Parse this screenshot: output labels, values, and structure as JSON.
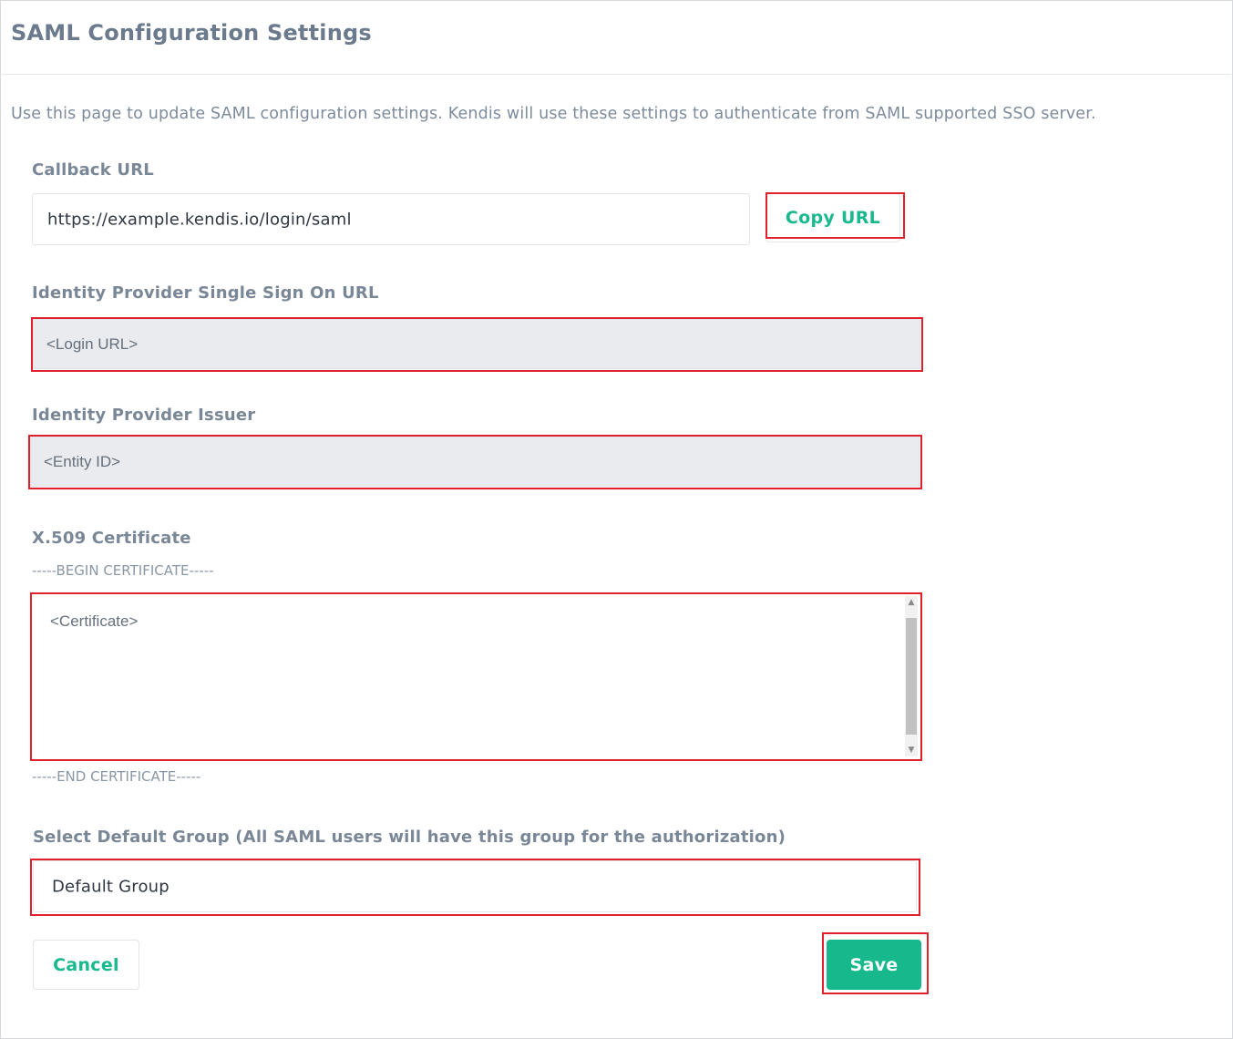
{
  "page": {
    "title": "SAML Configuration Settings",
    "description": "Use this page to update SAML configuration settings. Kendis will use these settings to authenticate from SAML supported SSO server."
  },
  "callback": {
    "label": "Callback URL",
    "value": "https://example.kendis.io/login/saml",
    "copy_button": "Copy URL"
  },
  "sso_url": {
    "label": "Identity Provider Single Sign On URL",
    "value": "<Login URL>"
  },
  "issuer": {
    "label": "Identity Provider Issuer",
    "value": "<Entity ID>"
  },
  "certificate": {
    "label": "X.509 Certificate",
    "begin": "-----BEGIN CERTIFICATE-----",
    "value": "<Certificate>",
    "end": "-----END CERTIFICATE-----"
  },
  "default_group": {
    "label": "Select Default Group (All SAML users will have this group for the authorization)",
    "value": "Default Group"
  },
  "actions": {
    "cancel": "Cancel",
    "save": "Save"
  },
  "colors": {
    "accent": "#17b98c",
    "highlight": "#e0202a",
    "label": "#7a8797"
  }
}
